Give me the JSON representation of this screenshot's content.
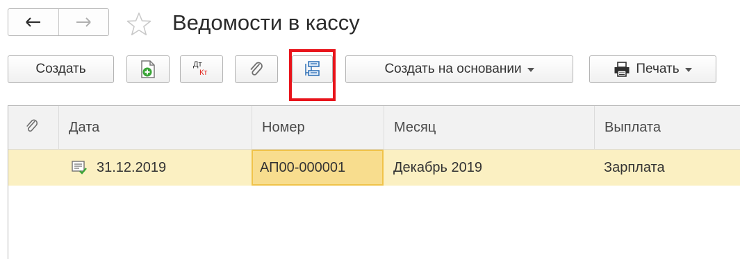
{
  "window": {
    "title": "Ведомости в кассу",
    "back_icon": "arrow-left-icon",
    "forward_icon": "arrow-right-icon",
    "favorite_icon": "star-outline-icon"
  },
  "toolbar": {
    "create_label": "Создать",
    "copy_icon": "document-add-icon",
    "dt_kt_top": "Дт",
    "dt_kt_bottom": "Кт",
    "attach_icon": "paperclip-icon",
    "structure_icon": "document-structure-icon",
    "create_based_on_label": "Создать на основании",
    "print_label": "Печать",
    "print_icon": "printer-icon",
    "highlight_color": "#e8141b"
  },
  "table": {
    "columns": [
      "Дата",
      "Номер",
      "Месяц",
      "Выплата"
    ],
    "attach_column_icon": "paperclip-icon",
    "rows": [
      {
        "status_icon": "posted-document-icon",
        "date": "31.12.2019",
        "number": "АП00-000001",
        "month": "Декабрь 2019",
        "payment": "Зарплата"
      }
    ],
    "selected_row_color": "#fbf0c2",
    "current_cell_color": "#f8dd8e"
  }
}
